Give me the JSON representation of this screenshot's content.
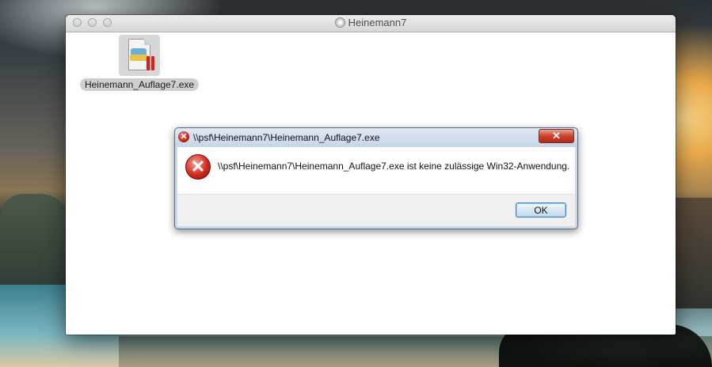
{
  "finder": {
    "title": "Heinemann7",
    "file": {
      "name": "Heinemann_Auflage7.exe",
      "icon": "exe-file-icon"
    }
  },
  "dialog": {
    "title": "\\\\psf\\Heinemann7\\Heinemann_Auflage7.exe",
    "message": "\\\\psf\\Heinemann7\\Heinemann_Auflage7.exe ist keine zulässige Win32-Anwendung.",
    "close_label": "✕",
    "ok_label": "OK",
    "icon": "error-icon"
  }
}
